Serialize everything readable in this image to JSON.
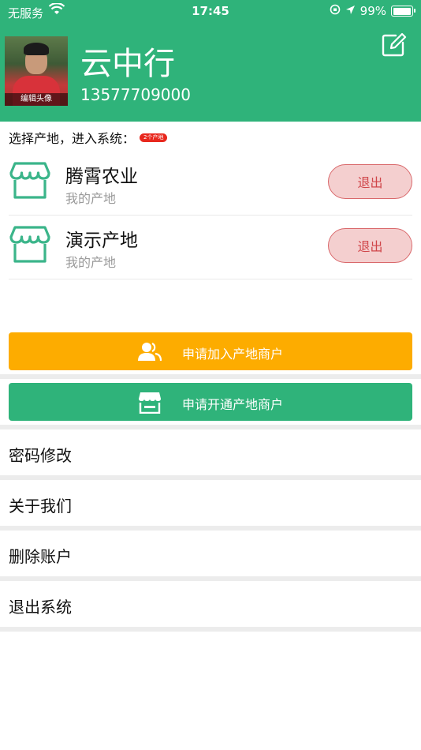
{
  "status_bar": {
    "carrier": "无服务",
    "time": "17:45",
    "battery": "99%"
  },
  "profile": {
    "avatar_caption": "编辑头像",
    "name": "云中行",
    "phone": "13577709000"
  },
  "farms_section": {
    "label": "选择产地，进入系统：",
    "badge": "2个产地",
    "items": [
      {
        "name": "腾霄农业",
        "subtitle": "我的产地",
        "logout_label": "退出"
      },
      {
        "name": "演示产地",
        "subtitle": "我的产地",
        "logout_label": "退出"
      }
    ]
  },
  "actions": {
    "join_label": "申请加入产地商户",
    "open_label": "申请开通产地商户"
  },
  "menu": {
    "items": [
      "密码修改",
      "关于我们",
      "删除账户",
      "退出系统"
    ]
  },
  "colors": {
    "primary_green": "#2fb37a",
    "orange": "#fdac00",
    "logout_red": "#d0464a"
  }
}
